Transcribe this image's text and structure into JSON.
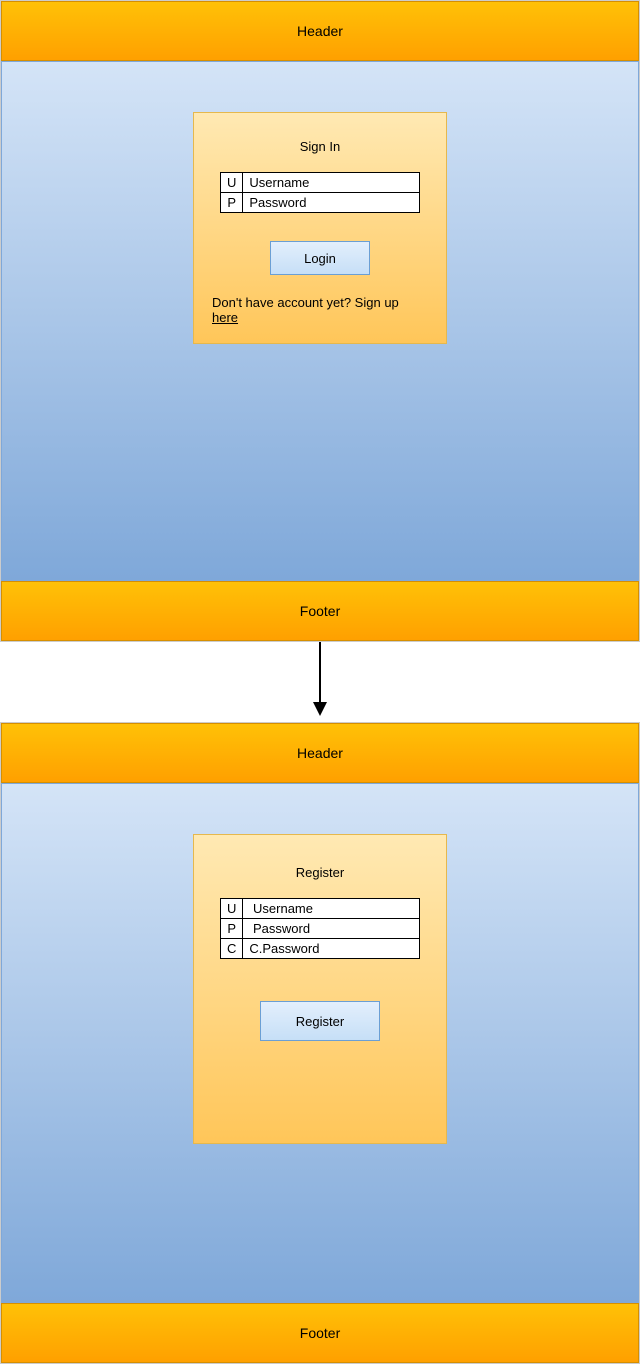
{
  "screen1": {
    "header": "Header",
    "footer": "Footer",
    "signin": {
      "title": "Sign In",
      "fields": {
        "username_icon": "U",
        "username_label": "Username",
        "password_icon": "P",
        "password_label": "Password"
      },
      "login_button": "Login",
      "signup_prompt": "Don't have account yet? Sign up ",
      "signup_link": "here"
    }
  },
  "screen2": {
    "header": "Header",
    "footer": "Footer",
    "register": {
      "title": "Register",
      "fields": {
        "username_icon": "U",
        "username_label": "Username",
        "password_icon": "P",
        "password_label": "Password",
        "confirm_icon": "C",
        "confirm_label": "C.Password"
      },
      "register_button": "Register"
    }
  }
}
